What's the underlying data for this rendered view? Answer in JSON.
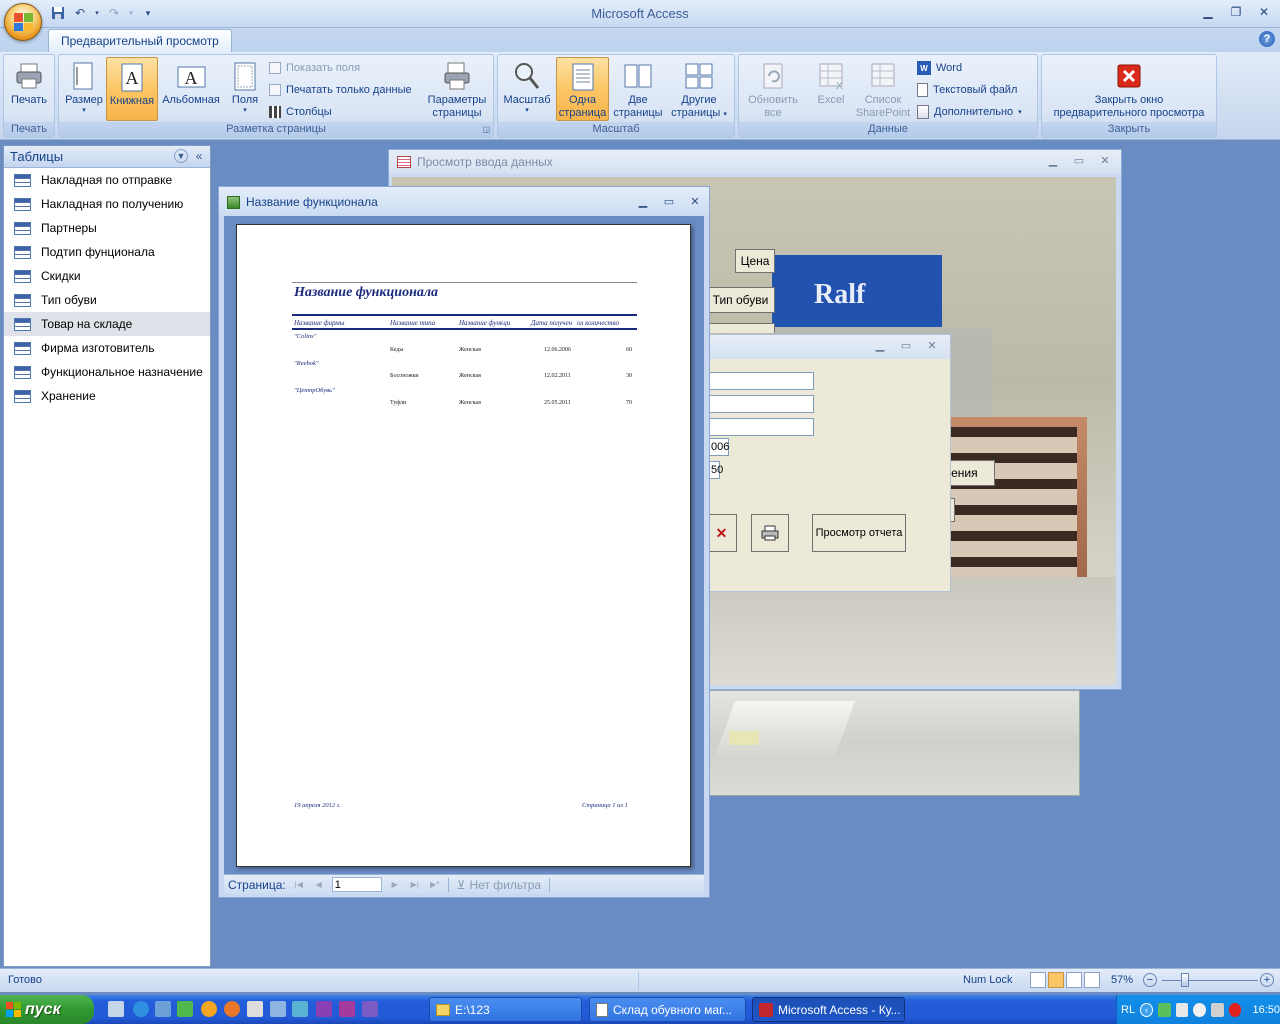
{
  "app": {
    "title": "Microsoft Access"
  },
  "tabs": {
    "active": "Предварительный просмотр"
  },
  "ribbon": {
    "print_group": {
      "print": "Печать",
      "label": "Печать"
    },
    "layout_group": {
      "size": "Размер",
      "portrait": "Книжная",
      "landscape": "Альбомная",
      "margins": "Поля",
      "show_fields": "Показать поля",
      "print_data_only": "Печатать только данные",
      "columns": "Столбцы",
      "page_setup_1": "Параметры",
      "page_setup_2": "страницы",
      "label": "Разметка страницы"
    },
    "zoom_group": {
      "zoom": "Масштаб",
      "one_page_1": "Одна",
      "one_page_2": "страница",
      "two_pages_1": "Две",
      "two_pages_2": "страницы",
      "other_pages_1": "Другие",
      "other_pages_2": "страницы",
      "label": "Масштаб"
    },
    "data_group": {
      "refresh_1": "Обновить",
      "refresh_2": "все",
      "excel": "Excel",
      "sp_1": "Список",
      "sp_2": "SharePoint",
      "word": "Word",
      "text_file": "Текстовый файл",
      "more": "Дополнительно",
      "label": "Данные"
    },
    "close_group": {
      "close_1": "Закрыть окно",
      "close_2": "предварительного просмотра",
      "label": "Закрыть"
    }
  },
  "nav": {
    "header": "Таблицы",
    "items": [
      "Накладная по отправке",
      "Накладная по получению",
      "Партнеры",
      "Подтип фунционала",
      "Скидки",
      "Тип обуви",
      "Товар на складе",
      "Фирма изготовитель",
      "Функциональное назначение",
      "Хранение"
    ],
    "selected_index": 6
  },
  "windows": {
    "data_entry": {
      "title": "Просмотр ввода данных"
    },
    "report": {
      "title": "Название функционала"
    }
  },
  "form": {
    "price_button": "Цена",
    "shoe_type_button": "Тип обуви",
    "store_sign": "Ralf",
    "field_value_1": "006",
    "field_value_2": "50",
    "partial_button": "вления",
    "report_button": "Просмотр отчета"
  },
  "report": {
    "title": "Название функционала",
    "columns": [
      "Название фирмы",
      "Название типа",
      "Название функци",
      "Дата получен",
      "ол количество"
    ],
    "groups": [
      {
        "firm": "\"Colins\"",
        "type": "Кеды",
        "func": "Женская",
        "date": "12.06.2006",
        "qty": "60"
      },
      {
        "firm": "\"Reebok\"",
        "type": "Босоножки",
        "func": "Женская",
        "date": "12.02.2011",
        "qty": "30"
      },
      {
        "firm": "\"ЦентрОбувь\"",
        "type": "Туфли",
        "func": "Женская",
        "date": "25.05.2011",
        "qty": "70"
      }
    ],
    "footer_date": "19 апреля 2012 г.",
    "footer_page": "Страница 1 из 1"
  },
  "pager": {
    "label": "Страница:",
    "value": "1",
    "filter": "Нет фильтра"
  },
  "status": {
    "left": "Готово",
    "numlock": "Num Lock",
    "zoom": "57%"
  },
  "taskbar": {
    "start": "пуск",
    "tasks": [
      "E:\\123",
      "Склад обувного маг...",
      "Microsoft Access - Ку..."
    ],
    "lang": "RL",
    "time": "16:50"
  },
  "colors": {
    "accent": "#15428b",
    "active_btn": "#fbc666",
    "workspace": "#6a8cc4",
    "report_ink": "#1b2a7a"
  }
}
